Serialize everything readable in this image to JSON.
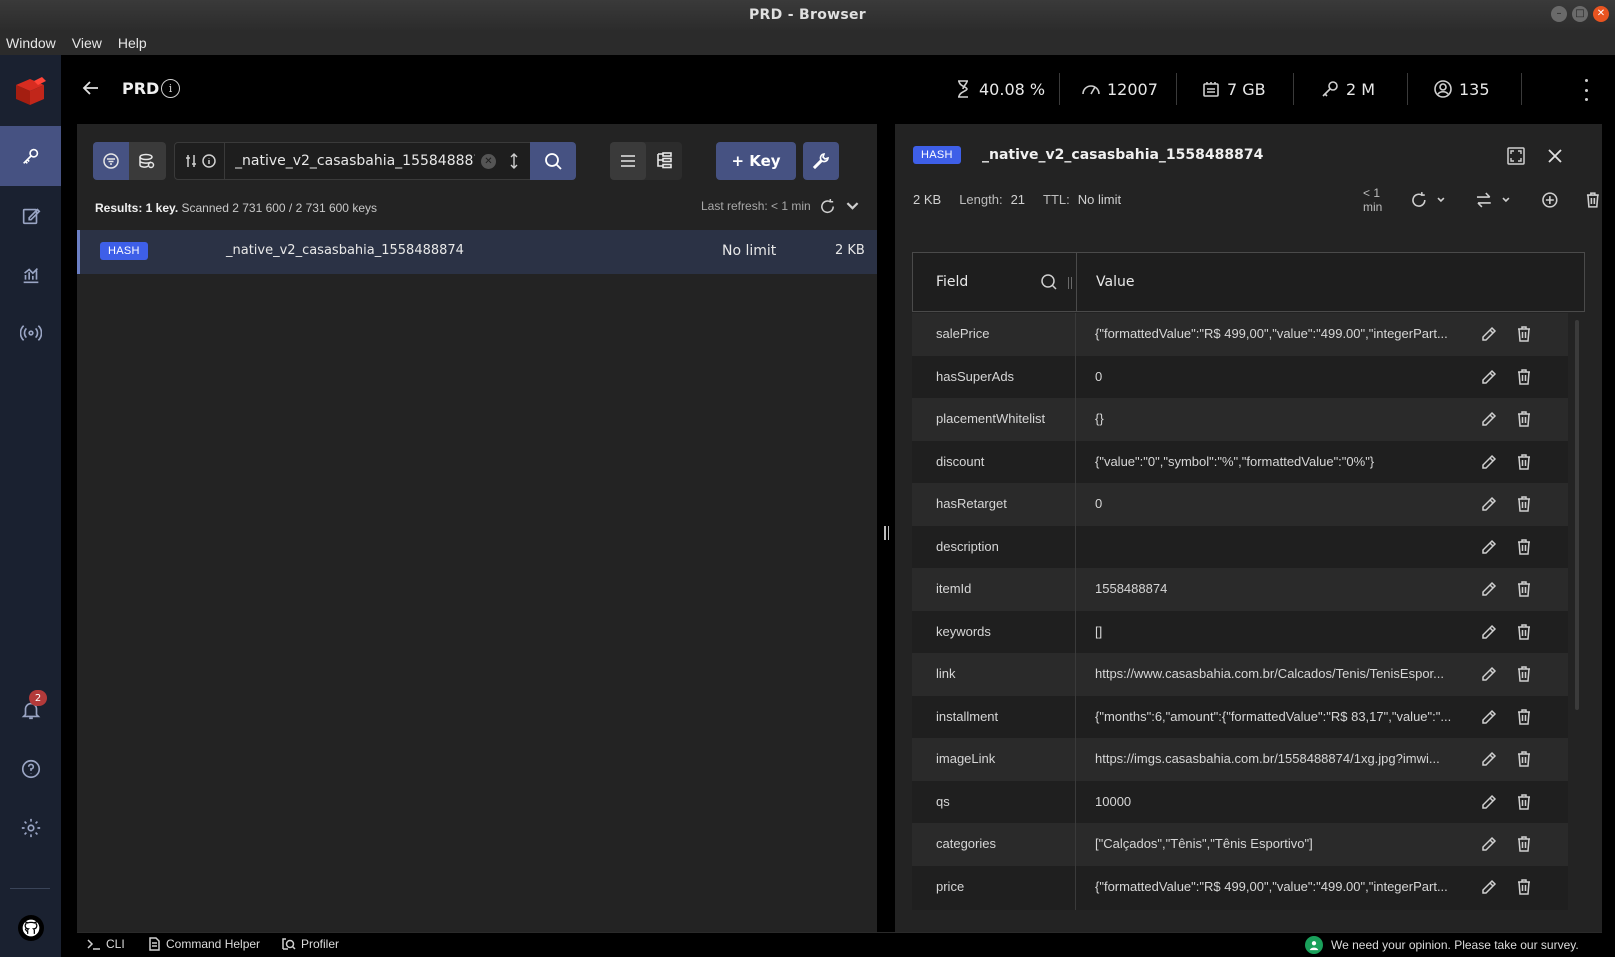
{
  "window": {
    "title": "PRD - Browser"
  },
  "menu": [
    "Window",
    "View",
    "Help"
  ],
  "nav": {
    "items": [
      {
        "name": "browser",
        "icon": "key-icon",
        "active": true
      },
      {
        "name": "workbench",
        "icon": "edit-icon"
      },
      {
        "name": "analytics",
        "icon": "chart-icon"
      },
      {
        "name": "pubsub",
        "icon": "broadcast-icon"
      }
    ],
    "notification_count": "2"
  },
  "header": {
    "db_name": "PRD",
    "metrics": [
      {
        "icon": "cpu-icon",
        "value": "40.08 %"
      },
      {
        "icon": "gauge-icon",
        "value": "12007"
      },
      {
        "icon": "memory-icon",
        "value": "7 GB"
      },
      {
        "icon": "key-icon",
        "value": "2 M"
      },
      {
        "icon": "user-icon",
        "value": "135"
      }
    ]
  },
  "browser": {
    "search_value": "_native_v2_casasbahia_1558488874",
    "add_key_label": "+ Key",
    "results_bold": "Results: 1 key.",
    "results_rest": "Scanned 2 731 600 / 2 731 600 keys",
    "last_refresh": "Last refresh: < 1 min",
    "keys": [
      {
        "type": "HASH",
        "name": "_native_v2_casasbahia_1558488874",
        "ttl": "No limit",
        "size": "2 KB"
      }
    ]
  },
  "details": {
    "type": "HASH",
    "key_name": "_native_v2_casasbahia_1558488874",
    "size": "2 KB",
    "length_label": "Length:",
    "length_value": "21",
    "ttl_label": "TTL:",
    "ttl_value": "No limit",
    "refresh_label": "< 1 min",
    "col_field": "Field",
    "col_value": "Value",
    "rows": [
      {
        "field": "salePrice",
        "value": "{\"formattedValue\":\"R$ 499,00\",\"value\":\"499.00\",\"integerPart..."
      },
      {
        "field": "hasSuperAds",
        "value": "0"
      },
      {
        "field": "placementWhitelist",
        "value": "{}"
      },
      {
        "field": "discount",
        "value": "{\"value\":\"0\",\"symbol\":\"%\",\"formattedValue\":\"0%\"}"
      },
      {
        "field": "hasRetarget",
        "value": "0"
      },
      {
        "field": "description",
        "value": ""
      },
      {
        "field": "itemId",
        "value": "1558488874"
      },
      {
        "field": "keywords",
        "value": "[]"
      },
      {
        "field": "link",
        "value": "https://www.casasbahia.com.br/Calcados/Tenis/TenisEspor..."
      },
      {
        "field": "installment",
        "value": "{\"months\":6,\"amount\":{\"formattedValue\":\"R$ 83,17\",\"value\":\"..."
      },
      {
        "field": "imageLink",
        "value": "https://imgs.casasbahia.com.br/1558488874/1xg.jpg?imwi..."
      },
      {
        "field": "qs",
        "value": "10000"
      },
      {
        "field": "categories",
        "value": "[\"Calçados\",\"Tênis\",\"Tênis Esportivo\"]"
      },
      {
        "field": "price",
        "value": "{\"formattedValue\":\"R$ 499,00\",\"value\":\"499.00\",\"integerPart..."
      }
    ]
  },
  "bottom": {
    "cli": "CLI",
    "command_helper": "Command Helper",
    "profiler": "Profiler",
    "survey": "We need your opinion. Please take our survey."
  },
  "colors": {
    "accent": "#465282",
    "hash_badge": "#3e5fe8",
    "nav_bg": "#1a2130"
  }
}
